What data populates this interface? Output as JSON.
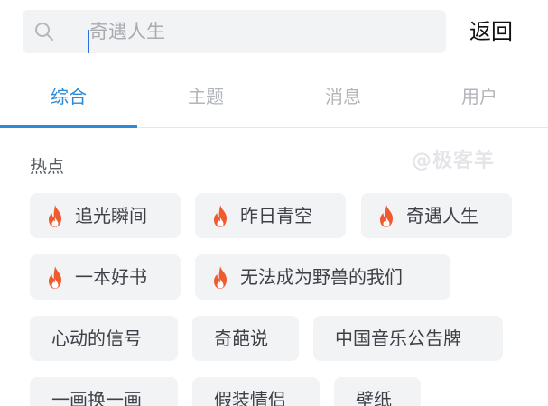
{
  "search": {
    "placeholder": "奇遇人生",
    "value": ""
  },
  "header": {
    "back_label": "返回"
  },
  "tabs": [
    {
      "label": "综合",
      "active": true
    },
    {
      "label": "主题",
      "active": false
    },
    {
      "label": "消息",
      "active": false
    },
    {
      "label": "用户",
      "active": false
    }
  ],
  "hot": {
    "title": "热点",
    "watermark": "@极客羊",
    "chips": [
      {
        "label": "追光瞬间",
        "hot": true
      },
      {
        "label": "昨日青空",
        "hot": true
      },
      {
        "label": "奇遇人生",
        "hot": true
      },
      {
        "label": "一本好书",
        "hot": true
      },
      {
        "label": "无法成为野兽的我们",
        "hot": true
      },
      {
        "label": "心动的信号",
        "hot": false
      },
      {
        "label": "奇葩说",
        "hot": false
      },
      {
        "label": "中国音乐公告牌",
        "hot": false
      },
      {
        "label": "一画换一画",
        "hot": false
      },
      {
        "label": "假装情侣",
        "hot": false
      },
      {
        "label": "壁纸",
        "hot": false
      }
    ]
  },
  "colors": {
    "accent": "#2b8bd9",
    "chip_bg": "#f2f3f5",
    "fire": "#ef5a2f"
  },
  "icons": {
    "search": "search-icon",
    "hot": "fire-icon"
  }
}
